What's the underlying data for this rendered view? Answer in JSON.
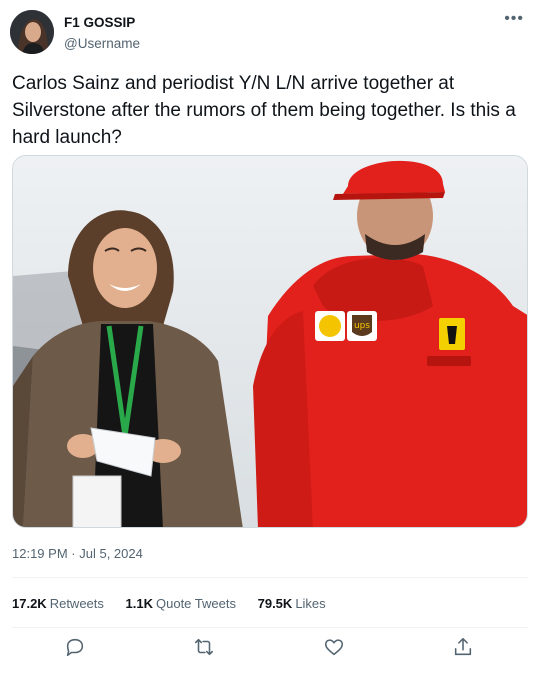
{
  "author": {
    "name": "F1 GOSSIP",
    "handle": "@Username",
    "avatar_icon": "avatar-photo"
  },
  "more_icon": "more-horizontal-icon",
  "tweet": {
    "text": "Carlos Sainz and periodist Y/N L/N arrive together at Silverstone after the rumors of them being together. Is this a hard launch?",
    "media": {
      "description_icon": "photo",
      "sponsor_logos": [
        "ups"
      ]
    }
  },
  "meta": {
    "time": "12:19 PM",
    "separator": "·",
    "date": "Jul 5, 2024"
  },
  "stats": [
    {
      "count": "17.2K",
      "label": "Retweets"
    },
    {
      "count": "1.1K",
      "label": "Quote Tweets"
    },
    {
      "count": "79.5K",
      "label": "Likes"
    }
  ],
  "actions": [
    "reply-icon",
    "retweet-icon",
    "like-icon",
    "share-icon"
  ],
  "colors": {
    "text_primary": "#0f1419",
    "text_secondary": "#536471",
    "divider": "#eff3f4",
    "ferrari_red": "#e2211c"
  }
}
